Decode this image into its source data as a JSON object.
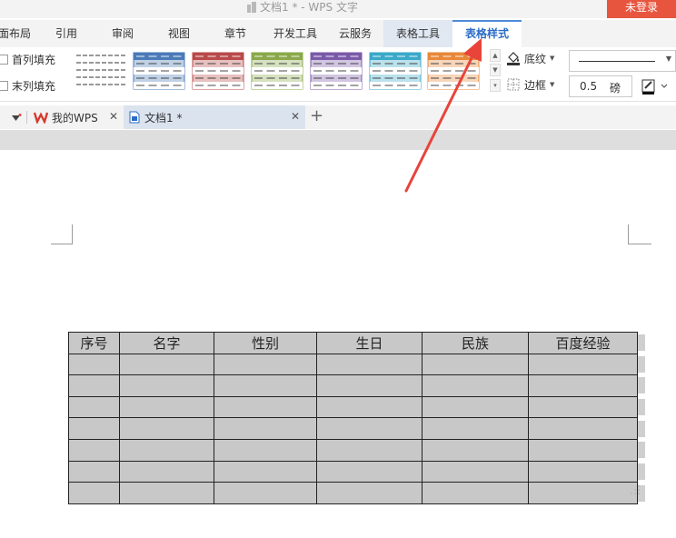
{
  "titlebar": {
    "doc_title": "文档1 * - WPS 文字",
    "login_label": "未登录"
  },
  "menu": {
    "tabs": [
      {
        "label": "面布局"
      },
      {
        "label": "引用"
      },
      {
        "label": "审阅"
      },
      {
        "label": "视图"
      },
      {
        "label": "章节"
      },
      {
        "label": "开发工具"
      },
      {
        "label": "云服务"
      },
      {
        "label": "表格工具"
      },
      {
        "label": "表格样式"
      }
    ],
    "active_tab": "表格样式"
  },
  "ribbon": {
    "first_col_fill": "首列填充",
    "last_col_fill": "末列填充",
    "shading_label": "底纹",
    "border_label": "边框",
    "line_weight_value": "0.5",
    "line_weight_unit": "磅",
    "style_colors": [
      "#4a7ab8",
      "#b94a4a",
      "#8aa84a",
      "#7a5aa8",
      "#3aa8c8",
      "#e8883a"
    ]
  },
  "doc_tabs": {
    "tabs": [
      {
        "label": "我的WPS"
      },
      {
        "label": "文档1 *"
      }
    ]
  },
  "table": {
    "headers": [
      "序号",
      "名字",
      "性别",
      "生日",
      "民族",
      "百度经验"
    ],
    "empty_rows": 7
  },
  "colors": {
    "accent": "#2a6cc6",
    "login": "#e8553f",
    "arrow": "#e8443a",
    "table_fill": "#c8c8c8"
  }
}
